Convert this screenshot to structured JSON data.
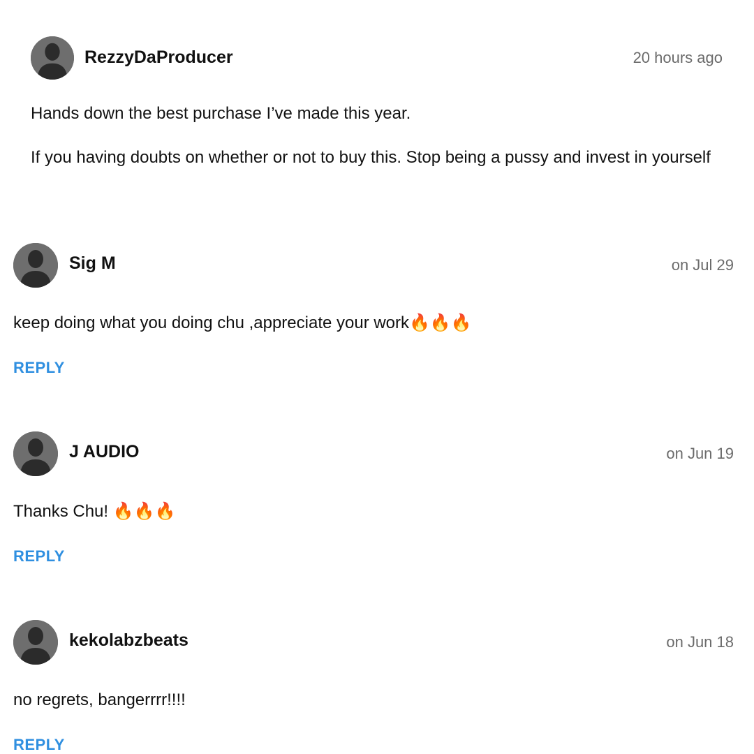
{
  "comments": [
    {
      "username": "RezzyDaProducer",
      "timestamp": "20 hours ago",
      "paragraphs": [
        "Hands down the best purchase I’ve made this year.",
        "If you having doubts on whether or not to buy this. Stop being a pussy and invest in yourself"
      ],
      "avatar_icon": "default-user-avatar"
    },
    {
      "username": "Sig M",
      "timestamp": "on Jul 29",
      "text": "keep doing what you doing chu ,appreciate your work",
      "emoji": "🔥🔥🔥",
      "reply_label": "REPLY",
      "avatar_icon": "default-user-avatar"
    },
    {
      "username": "J AUDIO",
      "timestamp": "on Jun 19",
      "text": "Thanks Chu! ",
      "emoji": "🔥🔥🔥",
      "reply_label": "REPLY",
      "avatar_icon": "default-user-avatar"
    },
    {
      "username": "kekolabzbeats",
      "timestamp": "on Jun 18",
      "text": "no regrets, bangerrrr!!!!",
      "reply_label": "REPLY",
      "avatar_icon": "default-user-avatar"
    }
  ],
  "colors": {
    "reply_link": "#2f8fe0",
    "timestamp": "#6b6b6b",
    "avatar_bg": "#6e6e6e",
    "avatar_silhouette": "#2b2b2b"
  }
}
